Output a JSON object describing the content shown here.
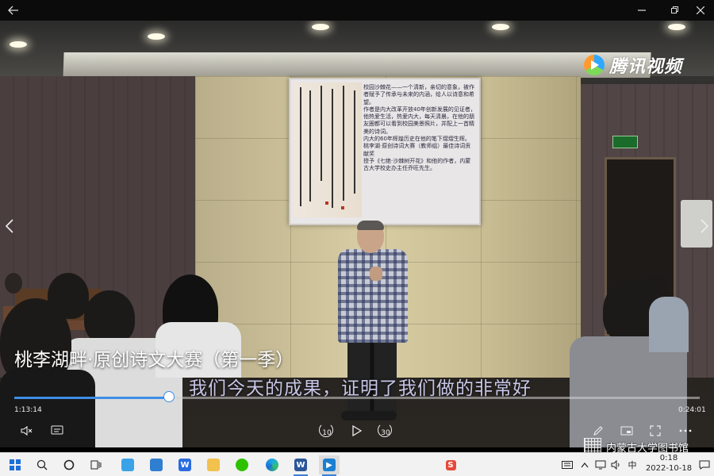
{
  "window": {
    "back_icon": "arrow-left-icon",
    "minimize_icon": "minimize-icon",
    "restore_icon": "restore-icon",
    "close_icon": "close-icon"
  },
  "overlay": {
    "logo_text": "腾讯视频",
    "video_title": "桃李湖畔·原创诗文大赛（第一季）",
    "subtitle": "我们今天的成果，证明了我们做的非常好",
    "watermark_text": "内蒙古大学图书馆"
  },
  "slide": {
    "paragraphs": [
      "校园沙棘花——一个清新，亲切的意象，被作者赋予了传承与未来的内涵，给人以诗意和希望。",
      "作者是内大改革开放40年创新发展的见证者，",
      "他热爱生活，热爱内大，每天清晨，在他的朋友圈都可以看到校园美景照片，并配上一首精美的诗词。",
      "内大的60年辉煌历史在他的笔下熠熠生辉。",
      "桃李湖·原创诗词大赛（教师组）最佳诗词贡献奖",
      "授予《七绝·沙棘树开花》和他的作者，内蒙古大学校史办主任乔旺先生。"
    ]
  },
  "player": {
    "current_time": "1:13:14",
    "total_time": "0:24:01",
    "progress": 0.226,
    "skip_back_label": "10",
    "skip_forward_label": "30",
    "accent_color": "#3d8ee8"
  },
  "taskbar": {
    "clock_time": "0:18",
    "clock_date": "2022-10-18",
    "ime_label": "中",
    "apps": [
      {
        "name": "start",
        "icon": "windows-start-icon"
      },
      {
        "name": "search",
        "icon": "search-icon"
      },
      {
        "name": "cortana",
        "icon": "circle-icon"
      },
      {
        "name": "task-view",
        "icon": "task-view-icon"
      },
      {
        "name": "explorer-pc",
        "icon": "computer-icon"
      },
      {
        "name": "store",
        "icon": "store-icon"
      },
      {
        "name": "wps",
        "icon": "wps-icon"
      },
      {
        "name": "file-explorer",
        "icon": "folder-icon"
      },
      {
        "name": "wechat",
        "icon": "wechat-icon"
      },
      {
        "name": "edge",
        "icon": "edge-icon"
      },
      {
        "name": "word",
        "icon": "word-icon"
      },
      {
        "name": "video-player",
        "icon": "video-player-icon"
      }
    ]
  }
}
